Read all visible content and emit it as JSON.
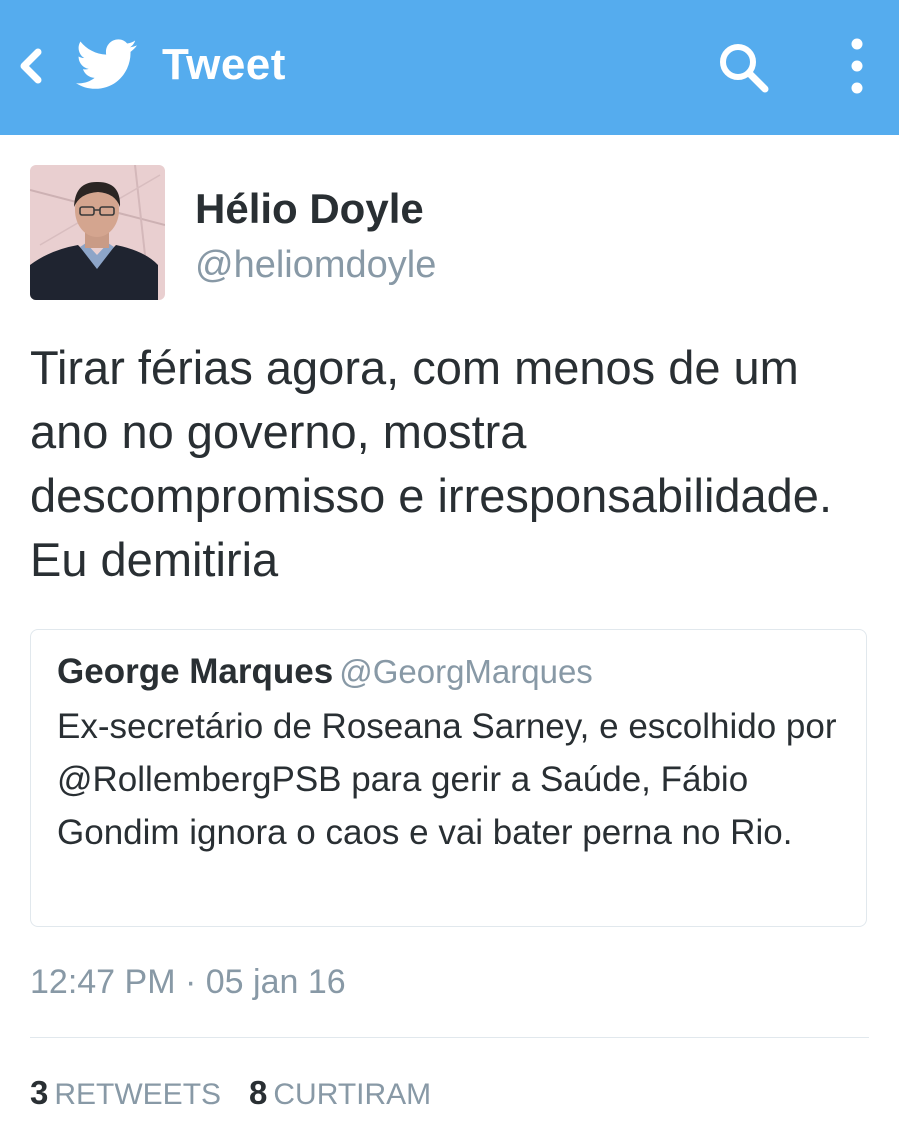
{
  "colors": {
    "topbar": "#55acee",
    "text_primary": "#292f33",
    "text_secondary": "#8899a6",
    "border": "#e1e8ed"
  },
  "topbar": {
    "back_icon": "chevron-left-icon",
    "logo_icon": "twitter-bird-icon",
    "title": "Tweet",
    "search_icon": "search-icon",
    "more_icon": "vertical-dots-icon"
  },
  "tweet": {
    "author_name": "Hélio Doyle",
    "author_handle": "@heliomdoyle",
    "text": "Tirar férias agora, com menos de um ano no governo, mostra descompromisso e irresponsabilidade. Eu demitiria",
    "quoted": {
      "author_name": "George Marques",
      "author_handle": "@GeorgMarques",
      "text": "Ex-secretário de Roseana Sarney, e escolhido por @RollembergPSB para gerir a Saúde, Fábio Gondim ignora o caos e vai bater perna no Rio."
    },
    "timestamp": "12:47 PM · 05 jan 16",
    "stats": {
      "retweets_count": "3",
      "retweets_label": "RETWEETS",
      "likes_count": "8",
      "likes_label": "CURTIRAM"
    }
  }
}
